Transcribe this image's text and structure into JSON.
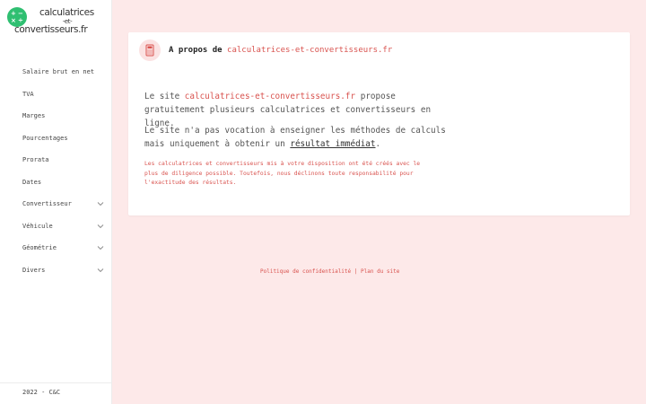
{
  "brand": {
    "line1": "calculatrices",
    "line2": "-et-",
    "line3": "convertisseurs.fr",
    "accent": "#2fbf71"
  },
  "sidebar": {
    "items": [
      {
        "label": "Salaire brut en net",
        "has_submenu": false
      },
      {
        "label": "TVA",
        "has_submenu": false
      },
      {
        "label": "Marges",
        "has_submenu": false
      },
      {
        "label": "Pourcentages",
        "has_submenu": false
      },
      {
        "label": "Prorata",
        "has_submenu": false
      },
      {
        "label": "Dates",
        "has_submenu": false
      },
      {
        "label": "Convertisseur",
        "has_submenu": true
      },
      {
        "label": "Véhicule",
        "has_submenu": true
      },
      {
        "label": "Géométrie",
        "has_submenu": true
      },
      {
        "label": "Divers",
        "has_submenu": true
      }
    ],
    "footer": "2022 - C&C"
  },
  "card": {
    "title_prefix": "A propos de",
    "title_link": "calculatrices-et-convertisseurs.fr",
    "icon": "calculator-icon",
    "p1_prefix": "Le site",
    "p1_link": "calculatrices-et-convertisseurs.fr",
    "p1_rest": "propose gratuitement plusieurs calculatrices et convertisseurs en ligne.",
    "p2_prefix": "Le site n'a pas vocation à enseigner les méthodes de calculs mais uniquement à obtenir un",
    "p2_underline": "résultat immédiat",
    "p2_end": ".",
    "disclaimer": "Les calculatrices et convertisseurs mis à votre disposition ont été créés avec le plus de diligence possible. Toutefois, nous déclinons toute responsabilité pour l'exactitude des résultats."
  },
  "footer": {
    "privacy": "Politique de confidentialité",
    "separator": "|",
    "sitemap": "Plan du site"
  },
  "colors": {
    "background": "#fde9e9",
    "link": "#d9534f"
  }
}
